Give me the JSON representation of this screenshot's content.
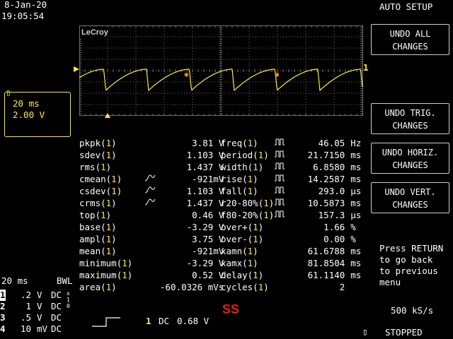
{
  "header": {
    "date": "8-Jan-20",
    "time": "19:05:54",
    "menu_title": "AUTO SETUP"
  },
  "logo": "LeCroy",
  "softkeys": [
    {
      "label": "UNDO ALL CHANGES"
    },
    {
      "label": "UNDO TRIG. CHANGES"
    },
    {
      "label": "UNDO HORIZ. CHANGES"
    },
    {
      "label": "UNDO VERT. CHANGES"
    }
  ],
  "channel_box": {
    "timebase": "20 ms",
    "volts": "2.00 V"
  },
  "trace_marker": "1",
  "measurements_left": [
    {
      "name": "pkpk",
      "ch": "1",
      "value": "3.81 V",
      "wave": false
    },
    {
      "name": "sdev",
      "ch": "1",
      "value": "1.103 V",
      "wave": false
    },
    {
      "name": "rms",
      "ch": "1",
      "value": "1.437 V",
      "wave": false
    },
    {
      "name": "cmean",
      "ch": "1",
      "value": "-921mV",
      "wave": true
    },
    {
      "name": "csdev",
      "ch": "1",
      "value": "1.103 V",
      "wave": true
    },
    {
      "name": "crms",
      "ch": "1",
      "value": "1.437 V",
      "wave": true
    },
    {
      "name": "top",
      "ch": "1",
      "value": "0.46 V",
      "wave": false
    },
    {
      "name": "base",
      "ch": "1",
      "value": "-3.29 V",
      "wave": false
    },
    {
      "name": "ampl",
      "ch": "1",
      "value": "3.75 V",
      "wave": false
    },
    {
      "name": "mean",
      "ch": "1",
      "value": "-921mV",
      "wave": false
    },
    {
      "name": "minimum",
      "ch": "1",
      "value": "-3.29 V",
      "wave": false
    },
    {
      "name": "maximum",
      "ch": "1",
      "value": "0.52 V",
      "wave": false
    },
    {
      "name": "area",
      "ch": "1",
      "value": "-60.0326 mVs",
      "wave": false
    }
  ],
  "measurements_right": [
    {
      "name": "freq",
      "ch": "1",
      "value": "46.05",
      "unit": "Hz",
      "pulse": true
    },
    {
      "name": "period",
      "ch": "1",
      "value": "21.7150",
      "unit": "ms",
      "pulse": true
    },
    {
      "name": "width",
      "ch": "1",
      "value": "6.8580",
      "unit": "ms",
      "pulse": true
    },
    {
      "name": "rise",
      "ch": "1",
      "value": "14.2587",
      "unit": "ms",
      "pulse": true
    },
    {
      "name": "fall",
      "ch": "1",
      "value": "293.0",
      "unit": "µs",
      "pulse": true
    },
    {
      "name": "r20-80%",
      "ch": "1",
      "value": "10.5873",
      "unit": "ms",
      "pulse": true
    },
    {
      "name": "f80-20%",
      "ch": "1",
      "value": "157.3",
      "unit": "µs",
      "pulse": true
    },
    {
      "name": "over+",
      "ch": "1",
      "value": "1.66",
      "unit": "%",
      "pulse": false
    },
    {
      "name": "over-",
      "ch": "1",
      "value": "0.00",
      "unit": "%",
      "pulse": false
    },
    {
      "name": "xamn",
      "ch": "1",
      "value": "61.6788",
      "unit": "ms",
      "pulse": false
    },
    {
      "name": "xamx",
      "ch": "1",
      "value": "81.8504",
      "unit": "ms",
      "pulse": false
    },
    {
      "name": "delay",
      "ch": "1",
      "value": "61.1140",
      "unit": "ms",
      "pulse": false
    },
    {
      "name": "cycles",
      "ch": "1",
      "value": "2",
      "unit": "",
      "pulse": false
    }
  ],
  "help_text": "Press RETURN\nto go back\nto previous\nmenu",
  "sample_rate": "500 kS/s",
  "acq_status": "STOPPED",
  "bottom_left": {
    "timebase": "20 ms",
    "bwl": "BWL",
    "channels": [
      {
        "num": "1",
        "scale": ".2",
        "unit": "V",
        "coupling": "DC",
        "extra": "x10"
      },
      {
        "num": "2",
        "scale": "1",
        "unit": "V",
        "coupling": "DC",
        "extra": ""
      },
      {
        "num": "3",
        "scale": ".5",
        "unit": "V",
        "coupling": "DC",
        "extra": ""
      },
      {
        "num": "4",
        "scale": "10",
        "unit": "mV",
        "coupling": "DC",
        "extra": ""
      }
    ]
  },
  "trigger": {
    "channel": "1",
    "coupling": "DC",
    "level": "0.68 V"
  },
  "ss_mark": "SS",
  "colors": {
    "trace": "#ffe84a",
    "grid": "#707070",
    "ss": "#e0201e"
  }
}
